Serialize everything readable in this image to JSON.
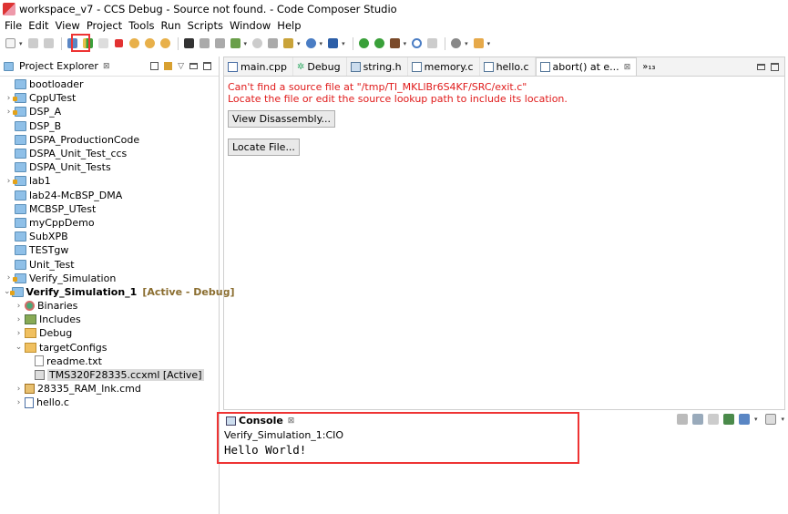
{
  "window": {
    "title": "workspace_v7 - CCS Debug - Source not found. - Code Composer Studio"
  },
  "menu": [
    "File",
    "Edit",
    "View",
    "Project",
    "Tools",
    "Run",
    "Scripts",
    "Window",
    "Help"
  ],
  "project_explorer": {
    "title": "Project Explorer",
    "close": "⊠",
    "items": [
      {
        "label": "bootloader"
      },
      {
        "label": "CppUTest"
      },
      {
        "label": "DSP_A"
      },
      {
        "label": "DSP_B"
      },
      {
        "label": "DSPA_ProductionCode"
      },
      {
        "label": "DSPA_Unit_Test_ccs"
      },
      {
        "label": "DSPA_Unit_Tests"
      },
      {
        "label": "lab1"
      },
      {
        "label": "lab24-McBSP_DMA"
      },
      {
        "label": "MCBSP_UTest"
      },
      {
        "label": "myCppDemo"
      },
      {
        "label": "SubXPB"
      },
      {
        "label": "TESTgw"
      },
      {
        "label": "Unit_Test"
      },
      {
        "label": "Verify_Simulation"
      },
      {
        "label": "Verify_Simulation_1",
        "tag": "[Active - Debug]"
      },
      {
        "label": "Binaries"
      },
      {
        "label": "Includes"
      },
      {
        "label": "Debug"
      },
      {
        "label": "targetConfigs"
      },
      {
        "label": "readme.txt"
      },
      {
        "label": "TMS320F28335.ccxml [Active]"
      },
      {
        "label": "28335_RAM_lnk.cmd"
      },
      {
        "label": "hello.c"
      }
    ]
  },
  "editor": {
    "tabs": [
      {
        "label": "main.cpp"
      },
      {
        "label": "Debug"
      },
      {
        "label": "string.h"
      },
      {
        "label": "memory.c"
      },
      {
        "label": "hello.c"
      },
      {
        "label": "abort() at e..."
      }
    ],
    "tab_overflow": "»₁₃",
    "message_line1": "Can't find a source file at \"/tmp/TI_MKLlBr6S4KF/SRC/exit.c\"",
    "message_line2": "Locate the file or edit the source lookup path to include its location.",
    "view_disassembly": "View Disassembly...",
    "locate_file": "Locate File..."
  },
  "console": {
    "title": "Console",
    "close": "⊠",
    "subtitle": "Verify_Simulation_1:CIO",
    "output": "Hello World!"
  },
  "colors": {
    "error_text": "#e01b1b",
    "highlight_border": "#e33333",
    "active_tag": "#8a6d2f"
  }
}
